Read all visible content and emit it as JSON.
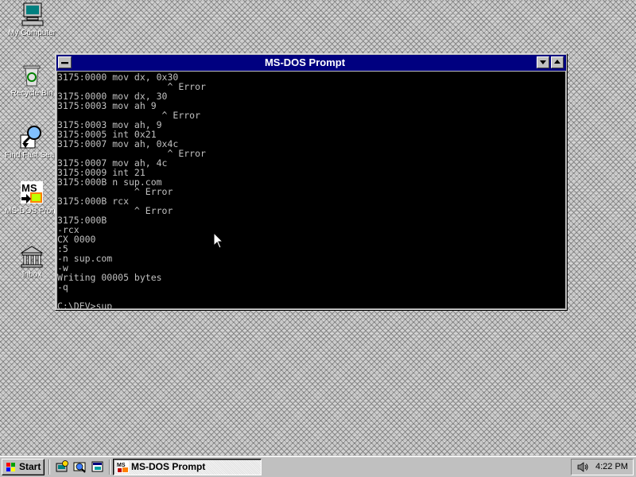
{
  "desktop": {
    "icons": [
      {
        "label": "My Computer",
        "icon": "my-computer-icon"
      },
      {
        "label": "Recycle Bin",
        "icon": "recycle-bin-icon"
      },
      {
        "label": "Find Fast Search",
        "icon": "magnifier-icon"
      },
      {
        "label": "MS-DOS Prompt",
        "icon": "ms-dos-icon"
      },
      {
        "label": "Inbox",
        "icon": "inbox-icon"
      }
    ]
  },
  "window": {
    "title": "MS-DOS Prompt",
    "console_lines": [
      "3175:0000 mov dx, 0x30",
      "                    ^ Error",
      "3175:0000 mov dx, 30",
      "3175:0003 mov ah 9",
      "                   ^ Error",
      "3175:0003 mov ah, 9",
      "3175:0005 int 0x21",
      "3175:0007 mov ah, 0x4c",
      "                    ^ Error",
      "3175:0007 mov ah, 4c",
      "3175:0009 int 21",
      "3175:000B n sup.com",
      "              ^ Error",
      "3175:000B rcx",
      "              ^ Error",
      "3175:000B",
      "-rcx",
      "CX 0000",
      ":5",
      "-n sup.com",
      "-w",
      "Writing 00005 bytes",
      "-q",
      ""
    ],
    "prompt_line": "C:\\DEV>sup"
  },
  "taskbar": {
    "start_label": "Start",
    "quick_launch": [
      "internet-explorer-icon",
      "outlook-express-icon",
      "show-desktop-icon"
    ],
    "task_button_label": "MS-DOS Prompt",
    "clock": "4:22 PM",
    "tray_icon": "speaker-icon"
  },
  "colors": {
    "titlebar": "#000080",
    "console_bg": "#000000",
    "console_fg": "#c0c0c0",
    "face": "#c0c0c0"
  }
}
